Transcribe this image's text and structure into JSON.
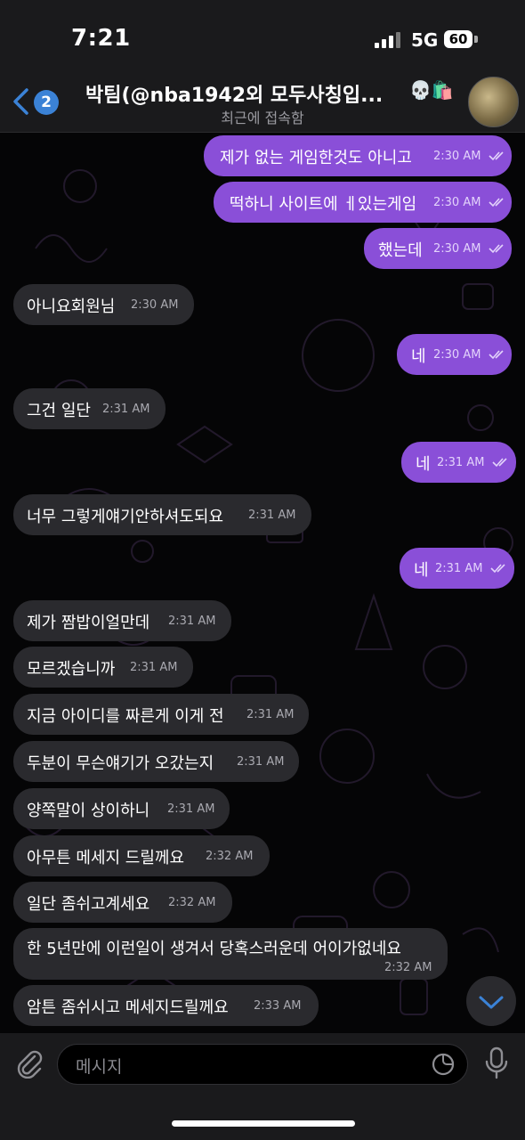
{
  "status": {
    "time": "7:21",
    "network": "5G",
    "battery": "60"
  },
  "header": {
    "back_badge": "2",
    "title": "박팀(@nba1942외 모두사칭입...",
    "title_emoji": "💀🛍️",
    "subtitle": "최근에 접속함"
  },
  "messages": [
    {
      "text": "제가 없는 게임한것도 아니고",
      "time": "2:30 AM",
      "dir": "out"
    },
    {
      "text": "떡하니 사이트에 ㅔ있는게임",
      "time": "2:30 AM",
      "dir": "out"
    },
    {
      "text": "했는데",
      "time": "2:30 AM",
      "dir": "out"
    },
    {
      "text": "아니요회원님",
      "time": "2:30 AM",
      "dir": "in"
    },
    {
      "text": "네",
      "time": "2:30 AM",
      "dir": "out"
    },
    {
      "text": "그건 일단",
      "time": "2:31 AM",
      "dir": "in"
    },
    {
      "text": "네",
      "time": "2:31 AM",
      "dir": "out"
    },
    {
      "text": "너무 그렇게얘기안하셔도되요",
      "time": "2:31 AM",
      "dir": "in"
    },
    {
      "text": "네",
      "time": "2:31 AM",
      "dir": "out"
    },
    {
      "text": "제가 짬밥이얼만데",
      "time": "2:31 AM",
      "dir": "in"
    },
    {
      "text": "모르겠습니까",
      "time": "2:31 AM",
      "dir": "in"
    },
    {
      "text": "지금 아이디를 짜른게 이게 전",
      "time": "2:31 AM",
      "dir": "in"
    },
    {
      "text": "두분이 무슨얘기가 오갔는지",
      "time": "2:31 AM",
      "dir": "in"
    },
    {
      "text": "양쪽말이 상이하니",
      "time": "2:31 AM",
      "dir": "in"
    },
    {
      "text": "아무튼 메세지 드릴께요",
      "time": "2:32 AM",
      "dir": "in"
    },
    {
      "text": "일단 좀쉬고계세요",
      "time": "2:32 AM",
      "dir": "in"
    },
    {
      "text": "한 5년만에 이런일이 생겨서 당혹스러운데 어이가없네요",
      "time": "2:32 AM",
      "dir": "in"
    },
    {
      "text": "암튼 좀쉬시고 메세지드릴께요",
      "time": "2:33 AM",
      "dir": "in"
    }
  ],
  "input": {
    "placeholder": "메시지"
  },
  "colors": {
    "outgoing": "#8a4fd8",
    "incoming": "#2a2a2e",
    "accent": "#3b82d6"
  },
  "icons": {
    "back": "chevron-left-icon",
    "attach": "paperclip-icon",
    "sticker": "sticker-icon",
    "mic": "microphone-icon",
    "scroll": "chevron-down-icon",
    "read": "double-check-icon"
  }
}
